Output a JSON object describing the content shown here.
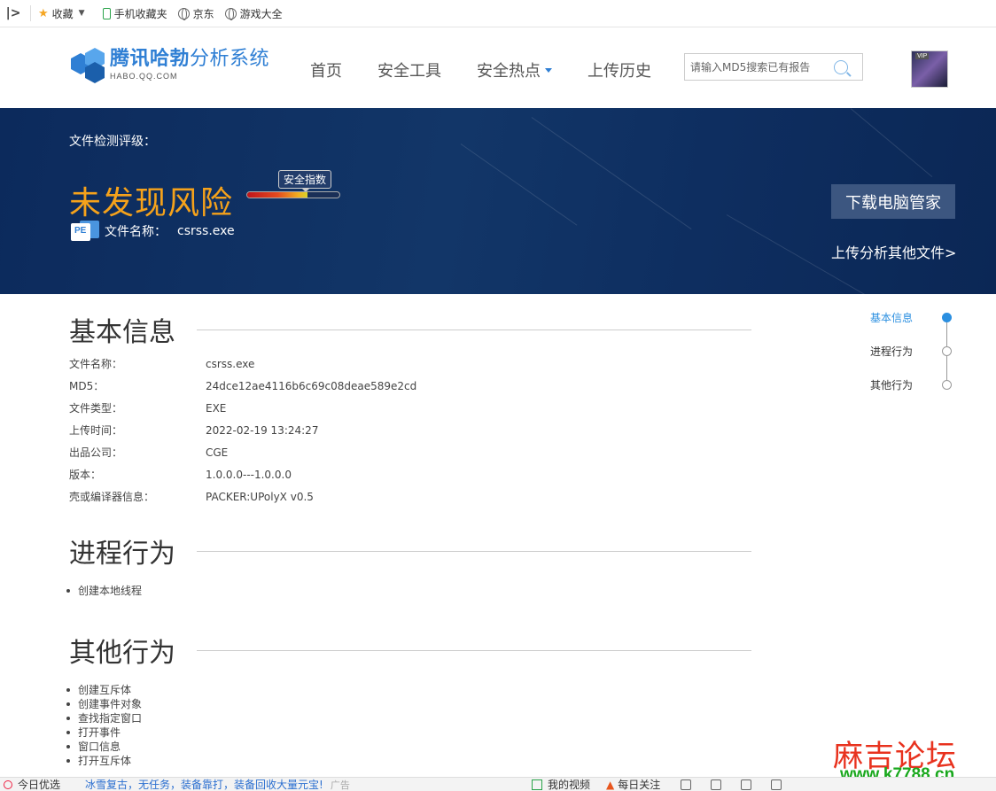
{
  "bookmarks": {
    "toggle_icon": "sidebar-toggle-icon",
    "items": [
      {
        "label": "收藏",
        "icon": "star-icon"
      },
      {
        "label": "手机收藏夹",
        "icon": "phone-icon"
      },
      {
        "label": "京东",
        "icon": "globe-icon"
      },
      {
        "label": "游戏大全",
        "icon": "globe-icon"
      }
    ]
  },
  "header": {
    "logo_title_bold": "腾讯哈勃",
    "logo_title_rest": "分析系统",
    "logo_sub": "HABO.QQ.COM",
    "nav": [
      "首页",
      "安全工具",
      "安全热点",
      "上传历史"
    ],
    "search_placeholder": "请输入MD5搜索已有报告",
    "avatar_badge": "VIP"
  },
  "banner": {
    "rating_label": "文件检测评级：",
    "verdict": "未发现风险",
    "safety_label": "安全指数",
    "safety_level_percent": 65,
    "file_name_label": "文件名称：",
    "file_name": "csrss.exe",
    "file_icon_tag": "PE",
    "download_button": "下载电脑管家",
    "upload_other": "上传分析其他文件>"
  },
  "basic_info": {
    "title": "基本信息",
    "rows": [
      {
        "k": "文件名称：",
        "v": "csrss.exe"
      },
      {
        "k": "MD5：",
        "v": "24dce12ae4116b6c69c08deae589e2cd"
      },
      {
        "k": "文件类型：",
        "v": "EXE"
      },
      {
        "k": "上传时间：",
        "v": "2022-02-19 13:24:27"
      },
      {
        "k": "出品公司：",
        "v": "CGE"
      },
      {
        "k": "版本：",
        "v": "1.0.0.0---1.0.0.0"
      },
      {
        "k": "壳或编译器信息：",
        "v": "PACKER:UPolyX v0.5"
      }
    ]
  },
  "process": {
    "title": "进程行为",
    "items": [
      "创建本地线程"
    ]
  },
  "other": {
    "title": "其他行为",
    "items": [
      "创建互斥体",
      "创建事件对象",
      "查找指定窗口",
      "打开事件",
      "窗口信息",
      "打开互斥体"
    ]
  },
  "side_nav": [
    "基本信息",
    "进程行为",
    "其他行为"
  ],
  "watermark": {
    "cn": "麻吉论坛",
    "url": "www.k7788.cn"
  },
  "status_bar": {
    "today": "今日优选",
    "ad": "冰雪复古，无任务，装备靠打，装备回收大量元宝!",
    "ad_tag": "广告",
    "video": "我的视频",
    "follow": "每日关注"
  },
  "colors": {
    "accent": "#2f7fd4",
    "verdict": "#f5a21b",
    "banner": "#123668",
    "active_nav": "#2b8fe0"
  }
}
